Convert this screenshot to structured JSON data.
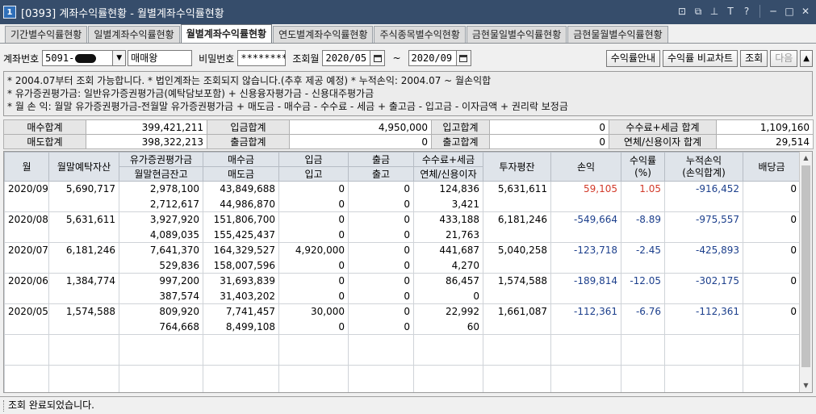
{
  "window": {
    "icon_text": "1",
    "title": "[0393] 계좌수익률현황 - 월별계좌수익률현황",
    "controls": [
      "⊡",
      "⧉",
      "⊥",
      "T",
      "?",
      "─",
      "□",
      "✕"
    ]
  },
  "tabs": [
    {
      "label": "기간별수익률현황",
      "active": false
    },
    {
      "label": "일별계좌수익률현황",
      "active": false
    },
    {
      "label": "월별계좌수익률현황",
      "active": true
    },
    {
      "label": "연도별계좌수익률현황",
      "active": false
    },
    {
      "label": "주식종목별수익현황",
      "active": false
    },
    {
      "label": "금현물일별수익률현황",
      "active": false
    },
    {
      "label": "금현물월별수익률현황",
      "active": false
    }
  ],
  "query": {
    "account_label": "계좌번호",
    "account_value": "5091-",
    "account_name": "매매왕",
    "password_label": "비밀번호",
    "password_value": "********",
    "month_label": "조회월",
    "from_month": "2020/05",
    "range_sep": "~",
    "to_month": "2020/09",
    "btn_guide": "수익률안내",
    "btn_compare": "수익률 비교차트",
    "btn_search": "조회",
    "btn_next": "다음",
    "btn_up": "▲"
  },
  "notes": [
    "* 2004.07부터 조회 가능합니다.   * 법인계좌는 조회되지 않습니다.(추후 제공 예정)   * 누적손익: 2004.07 ~ 월손익합",
    "* 유가증권평가금: 일반유가증권평가금(예탁담보포함) + 신용융자평가금 - 신용대주평가금",
    "* 월 손 익: 월말 유가증권평가금-전월말 유가증권평가금 + 매도금 - 매수금 - 수수료 - 세금 + 출고금 - 입고금 - 이자금액 + 권리락 보정금"
  ],
  "summary": {
    "row1": [
      {
        "label": "매수합계",
        "value": "399,421,211"
      },
      {
        "label": "입금합계",
        "value": "4,950,000"
      },
      {
        "label": "입고합계",
        "value": "0"
      },
      {
        "label": "수수료+세금 합계",
        "value": "1,109,160"
      }
    ],
    "row2": [
      {
        "label": "매도합계",
        "value": "398,322,213"
      },
      {
        "label": "출금합계",
        "value": "0"
      },
      {
        "label": "출고합계",
        "value": "0"
      },
      {
        "label": "연체/신용이자 합계",
        "value": "29,514"
      }
    ]
  },
  "grid": {
    "headers_top": [
      "월",
      "월말예탁자산",
      "유가증권평가금",
      "매수금",
      "입금",
      "출금",
      "수수료+세금",
      "투자평잔",
      "손익",
      "수익률\n(%)",
      "누적손익\n(손익합계)",
      "배당금"
    ],
    "headers_bottom": [
      "월말현금잔고",
      "매도금",
      "입고",
      "출고",
      "연체/신용이자"
    ],
    "rows": [
      {
        "month": "2020/09",
        "deposit": "5,690,717",
        "sec": "2,978,100",
        "buy": "43,849,688",
        "in": "0",
        "out": "0",
        "fee": "124,836",
        "avg": "5,631,611",
        "pl": "59,105",
        "rate": "1.05",
        "cum": "-916,452",
        "div": "0",
        "cash": "2,712,617",
        "sell": "44,986,870",
        "recv": "0",
        "send": "0",
        "interest": "3,421"
      },
      {
        "month": "2020/08",
        "deposit": "5,631,611",
        "sec": "3,927,920",
        "buy": "151,806,700",
        "in": "0",
        "out": "0",
        "fee": "433,188",
        "avg": "6,181,246",
        "pl": "-549,664",
        "rate": "-8.89",
        "cum": "-975,557",
        "div": "0",
        "cash": "4,089,035",
        "sell": "155,425,437",
        "recv": "0",
        "send": "0",
        "interest": "21,763"
      },
      {
        "month": "2020/07",
        "deposit": "6,181,246",
        "sec": "7,641,370",
        "buy": "164,329,527",
        "in": "4,920,000",
        "out": "0",
        "fee": "441,687",
        "avg": "5,040,258",
        "pl": "-123,718",
        "rate": "-2.45",
        "cum": "-425,893",
        "div": "0",
        "cash": "529,836",
        "sell": "158,007,596",
        "recv": "0",
        "send": "0",
        "interest": "4,270"
      },
      {
        "month": "2020/06",
        "deposit": "1,384,774",
        "sec": "997,200",
        "buy": "31,693,839",
        "in": "0",
        "out": "0",
        "fee": "86,457",
        "avg": "1,574,588",
        "pl": "-189,814",
        "rate": "-12.05",
        "cum": "-302,175",
        "div": "0",
        "cash": "387,574",
        "sell": "31,403,202",
        "recv": "0",
        "send": "0",
        "interest": "0"
      },
      {
        "month": "2020/05",
        "deposit": "1,574,588",
        "sec": "809,920",
        "buy": "7,741,457",
        "in": "30,000",
        "out": "0",
        "fee": "22,992",
        "avg": "1,661,087",
        "pl": "-112,361",
        "rate": "-6.76",
        "cum": "-112,361",
        "div": "0",
        "cash": "764,668",
        "sell": "8,499,108",
        "recv": "0",
        "send": "0",
        "interest": "60"
      }
    ]
  },
  "status": "조회 완료되었습니다.",
  "colors": {
    "titlebar": "#364d6b",
    "negative": "#1c3f8c",
    "positive": "#d23a2a",
    "header": "#dfe4ea"
  }
}
